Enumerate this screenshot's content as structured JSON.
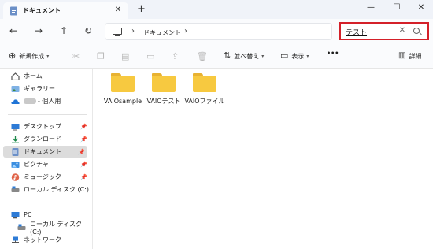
{
  "window": {
    "tab_title": "ドキュメント",
    "new_tab": "+",
    "close_tab": "✕",
    "minimize": "—",
    "maximize": "☐",
    "close": "✕"
  },
  "nav": {
    "back": "←",
    "forward": "→",
    "up": "↑",
    "refresh": "↻"
  },
  "address": {
    "breadcrumb": [
      "ドキュメント"
    ]
  },
  "search": {
    "value": "テスト",
    "clear": "✕"
  },
  "toolbar": {
    "new": "新規作成",
    "sort": "並べ替え",
    "view": "表示",
    "more": "•••",
    "details": "詳細"
  },
  "sidebar": {
    "items": [
      {
        "label": "ホーム",
        "icon": "home-icon"
      },
      {
        "label": "ギャラリー",
        "icon": "gallery-icon"
      },
      {
        "label": "- 個人用",
        "icon": "onedrive-icon"
      },
      {
        "label": "デスクトップ",
        "icon": "desktop-icon",
        "pinned": true
      },
      {
        "label": "ダウンロード",
        "icon": "download-icon",
        "pinned": true
      },
      {
        "label": "ドキュメント",
        "icon": "documents-icon",
        "pinned": true,
        "selected": true
      },
      {
        "label": "ピクチャ",
        "icon": "pictures-icon",
        "pinned": true
      },
      {
        "label": "ミュージック",
        "icon": "music-icon",
        "pinned": true
      },
      {
        "label": "ローカル ディスク (C:)",
        "icon": "drive-icon"
      },
      {
        "label": "PC",
        "icon": "pc-icon"
      },
      {
        "label": "ローカル ディスク (C:)",
        "icon": "drive-icon"
      },
      {
        "label": "ネットワーク",
        "icon": "network-icon"
      }
    ]
  },
  "files": [
    {
      "name": "VAIOsample",
      "type": "folder"
    },
    {
      "name": "VAIOテスト",
      "type": "folder"
    },
    {
      "name": "VAIOファイル",
      "type": "folder"
    }
  ],
  "colors": {
    "folder": "#f7c940",
    "highlight_box": "#d42029",
    "selected_bg": "#dcdcdc"
  }
}
